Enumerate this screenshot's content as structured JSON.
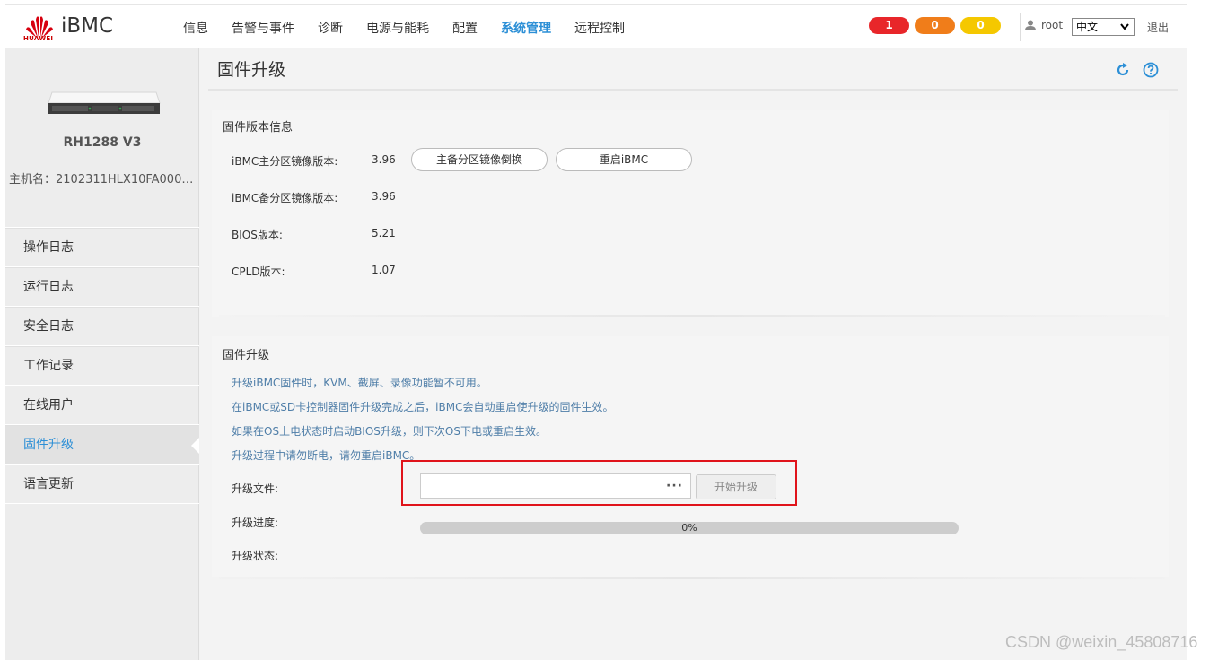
{
  "header": {
    "brand": "HUAWEI",
    "app_title": "iBMC",
    "nav": [
      "信息",
      "告警与事件",
      "诊断",
      "电源与能耗",
      "配置",
      "系统管理",
      "远程控制"
    ],
    "active_nav": "系统管理",
    "alarms": {
      "critical": "1",
      "major": "0",
      "minor": "0"
    },
    "username": "root",
    "language": "中文",
    "logout": "退出"
  },
  "sidebar": {
    "model": "RH1288 V3",
    "hostname": "主机名：2102311HLX10FA0003...",
    "items": [
      "操作日志",
      "运行日志",
      "安全日志",
      "工作记录",
      "在线用户",
      "固件升级",
      "语言更新"
    ],
    "active_item": "固件升级"
  },
  "main": {
    "page_title": "固件升级",
    "version_section": {
      "title": "固件版本信息",
      "rows": [
        {
          "label": "iBMC主分区镜像版本:",
          "value": "3.96"
        },
        {
          "label": "iBMC备分区镜像版本:",
          "value": "3.96"
        },
        {
          "label": "BIOS版本:",
          "value": "5.21"
        },
        {
          "label": "CPLD版本:",
          "value": "1.07"
        }
      ],
      "swap_button": "主备分区镜像倒换",
      "restart_button": "重启iBMC"
    },
    "upgrade_section": {
      "title": "固件升级",
      "notes": [
        "升级iBMC固件时，KVM、截屏、录像功能暂不可用。",
        "在iBMC或SD卡控制器固件升级完成之后，iBMC会自动重启使升级的固件生效。",
        "如果在OS上电状态时启动BIOS升级，则下次OS下电或重启生效。",
        "升级过程中请勿断电，请勿重启iBMC。"
      ],
      "file_label": "升级文件:",
      "file_value": "",
      "browse": "···",
      "start_button": "开始升级",
      "progress_label": "升级进度:",
      "progress_percent": 0,
      "progress_text": "0%",
      "status_label": "升级状态:",
      "status_value": ""
    }
  },
  "watermark": "CSDN @weixin_45808716",
  "colors": {
    "accent": "#2c8fd6",
    "critical": "#e8262a",
    "major": "#f07d1a",
    "minor": "#f5c800",
    "highlight": "#e0141b"
  }
}
